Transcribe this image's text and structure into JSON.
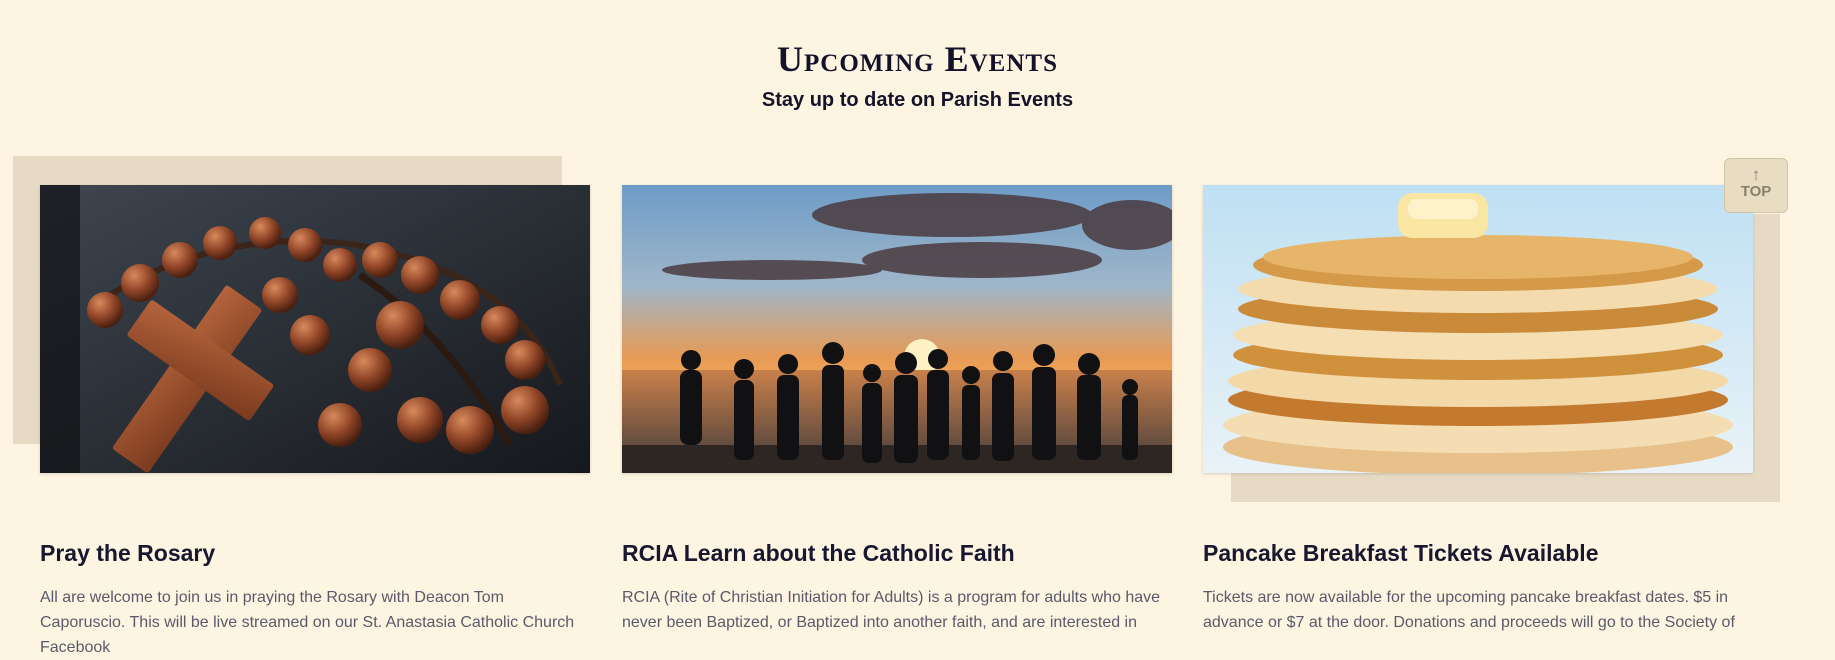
{
  "header": {
    "title": "Upcoming Events",
    "subtitle": "Stay up to date on Parish Events"
  },
  "events": [
    {
      "title": "Pray the Rosary",
      "description": "All are welcome to join  us in praying the Rosary with Deacon Tom Caporuscio. This will be live streamed on our St. Anastasia Catholic Church Facebook",
      "image_icon": "rosary-image"
    },
    {
      "title": "RCIA Learn about the Catholic Faith",
      "description": "RCIA (Rite of Christian Initiation for Adults) is a program for adults who have never been Baptized, or Baptized into another faith, and are interested in",
      "image_icon": "sunset-group-image"
    },
    {
      "title": "Pancake Breakfast Tickets Available",
      "description": "Tickets are now available for the upcoming pancake breakfast dates. $5 in advance or $7 at the door. Donations and proceeds will go to the Society of",
      "image_icon": "pancake-image"
    }
  ],
  "back_to_top": {
    "label": "TOP",
    "icon": "arrow-up-icon"
  },
  "colors": {
    "background": "#fdf4e1",
    "backdrop": "#e6dac4",
    "heading": "#12122a",
    "body_text": "#5a5a6a"
  }
}
